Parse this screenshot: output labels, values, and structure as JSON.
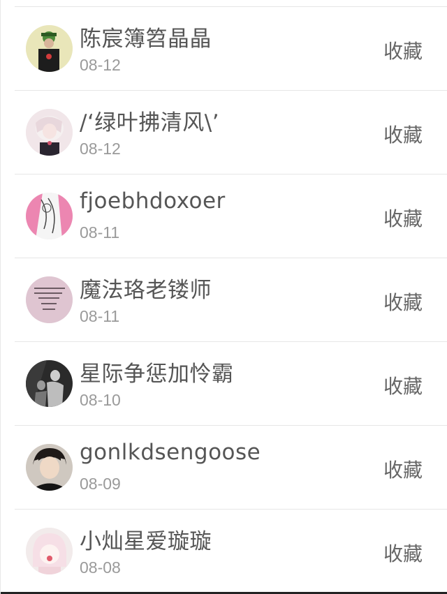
{
  "items": [
    {
      "name": "陈宸簿笤晶晶",
      "date": "08-12",
      "action": "收藏",
      "avatar": "avatar-green-hat"
    },
    {
      "name": "/‘绿叶拂清风\\’",
      "date": "08-12",
      "action": "收藏",
      "avatar": "avatar-pale-anime"
    },
    {
      "name": "fjoebhdoxoer",
      "date": "08-11",
      "action": "收藏",
      "avatar": "avatar-pink-sketch"
    },
    {
      "name": "魔法珞老镂师",
      "date": "08-11",
      "action": "收藏",
      "avatar": "avatar-pink-text"
    },
    {
      "name": "星际争惩加怜霸",
      "date": "08-10",
      "action": "收藏",
      "avatar": "avatar-dark-figures"
    },
    {
      "name": "gonlkdsengoose",
      "date": "08-09",
      "action": "收藏",
      "avatar": "avatar-person-photo"
    },
    {
      "name": "小灿星爱璇璇",
      "date": "08-08",
      "action": "收藏",
      "avatar": "avatar-pink-girl"
    }
  ]
}
